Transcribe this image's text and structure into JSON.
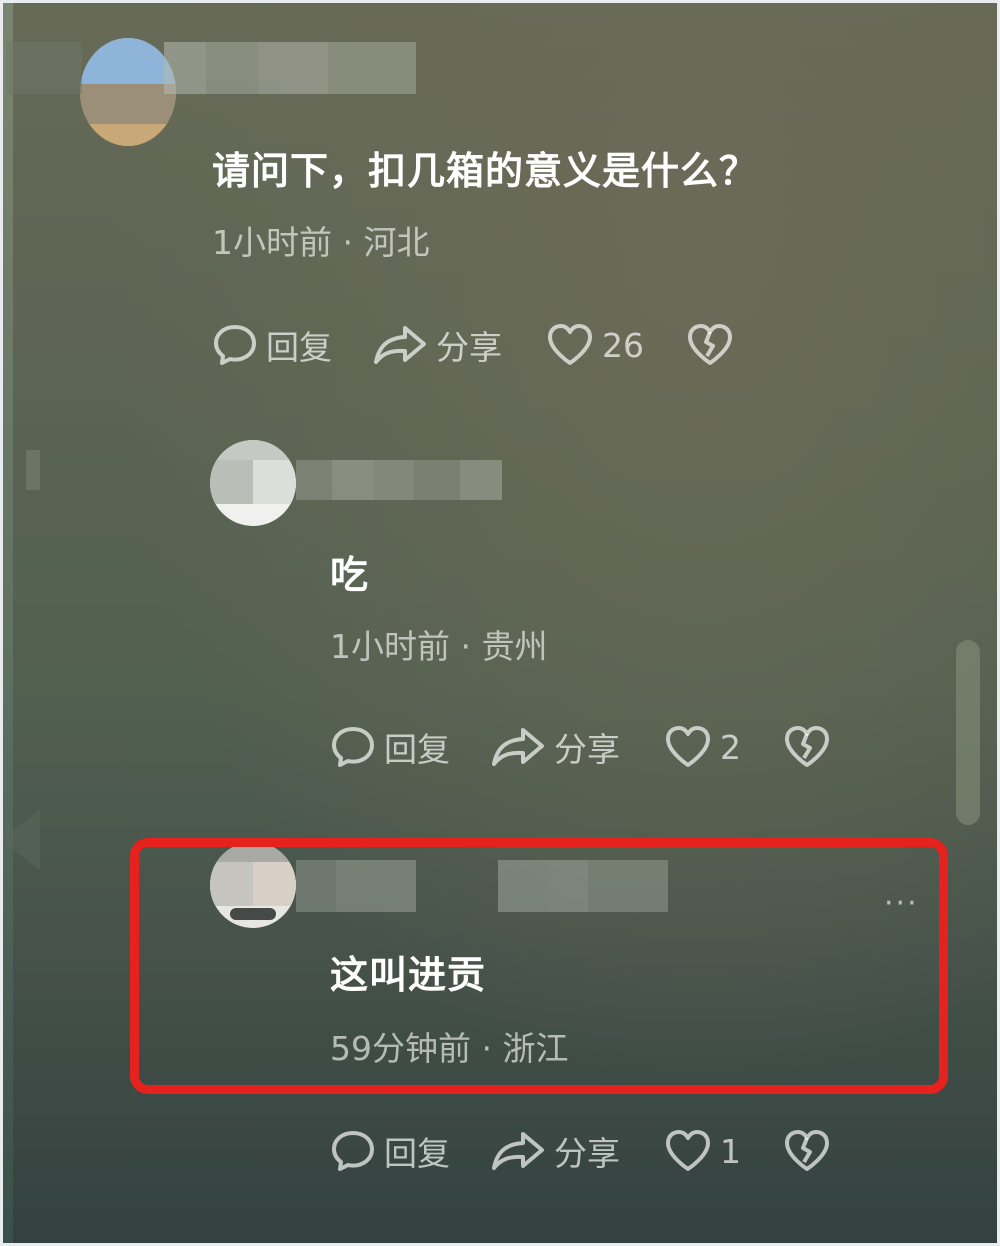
{
  "comments": [
    {
      "text": "请问下，扣几箱的意义是什么？",
      "meta": "1小时前 · 河北",
      "reply_label": "回复",
      "share_label": "分享",
      "like_count": "26"
    },
    {
      "text": "吃",
      "meta": "1小时前 · 贵州",
      "reply_label": "回复",
      "share_label": "分享",
      "like_count": "2"
    },
    {
      "text": "这叫进贡",
      "meta": "59分钟前 · 浙江",
      "reply_label": "回复",
      "share_label": "分享",
      "like_count": "1"
    }
  ],
  "more_menu": "···",
  "colors": {
    "highlight": "#e5221e",
    "text": "#ffffff"
  },
  "icons": [
    "comment-icon",
    "share-icon",
    "heart-icon",
    "broken-heart-icon"
  ]
}
